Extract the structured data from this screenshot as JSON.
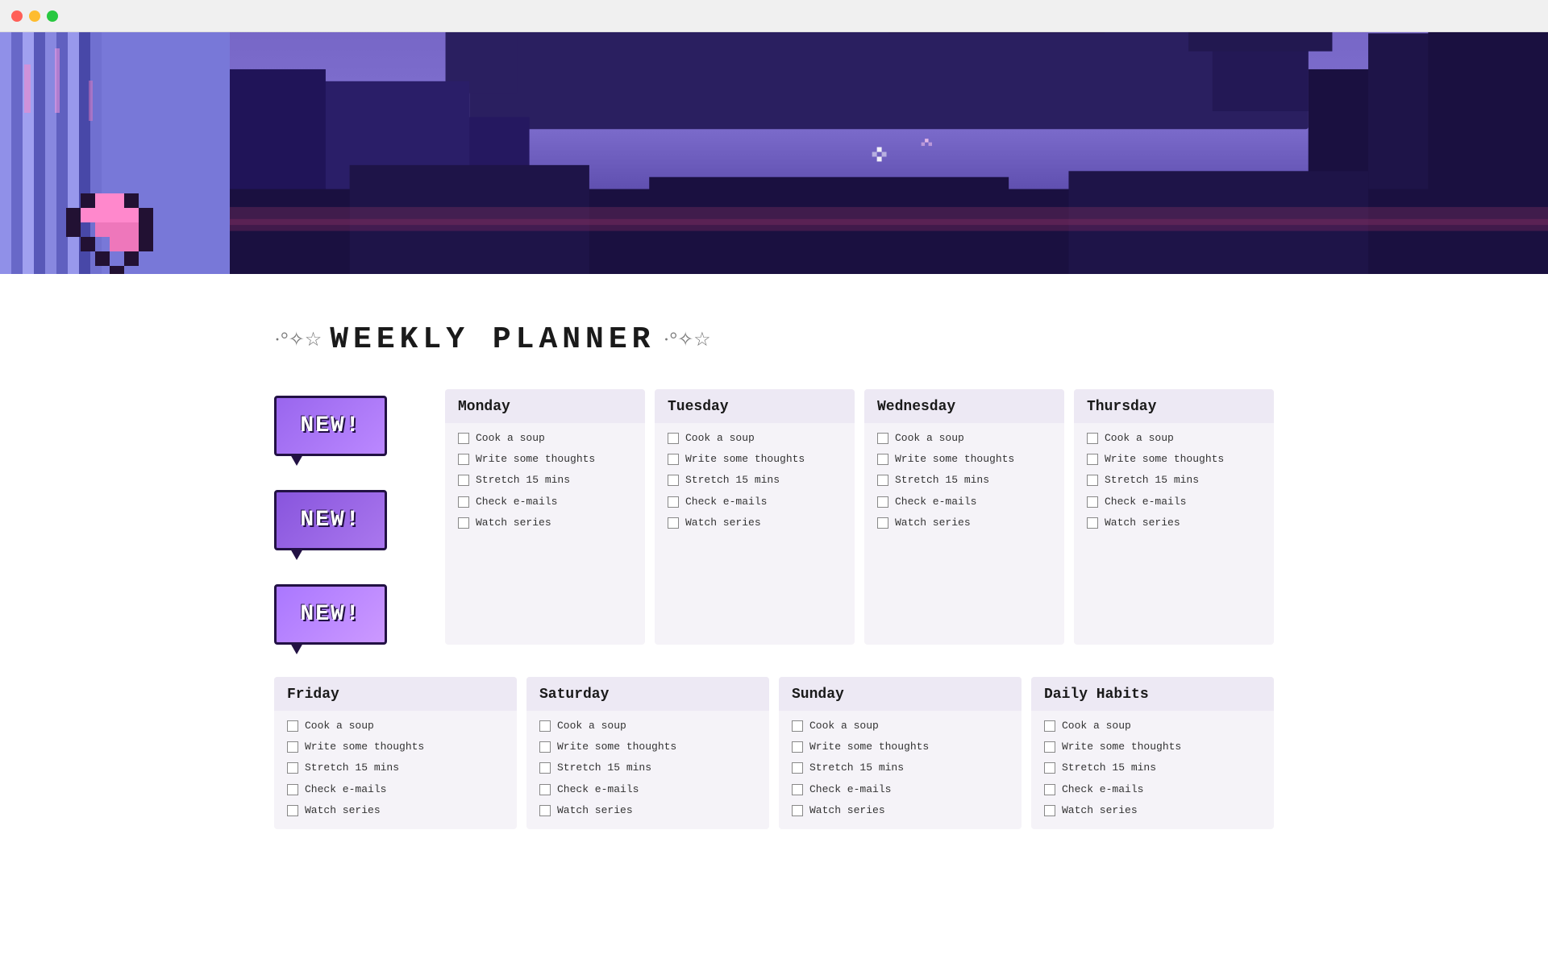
{
  "titlebar": {
    "buttons": [
      "close",
      "minimize",
      "maximize"
    ]
  },
  "title": "WEEKLY PLANNER",
  "title_deco_left": "·°✧☆",
  "title_deco_right": "·°✧☆",
  "days": [
    {
      "name": "Monday",
      "tasks": [
        "Cook a soup",
        "Write some thoughts",
        "Stretch 15 mins",
        "Check e-mails",
        "Watch series"
      ]
    },
    {
      "name": "Tuesday",
      "tasks": [
        "Cook a soup",
        "Write some thoughts",
        "Stretch 15 mins",
        "Check e-mails",
        "Watch series"
      ]
    },
    {
      "name": "Wednesday",
      "tasks": [
        "Cook a soup",
        "Write some thoughts",
        "Stretch 15 mins",
        "Check e-mails",
        "Watch series"
      ]
    },
    {
      "name": "Thursday",
      "tasks": [
        "Cook a soup",
        "Write some thoughts",
        "Stretch 15 mins",
        "Check e-mails",
        "Watch series"
      ]
    },
    {
      "name": "Friday",
      "tasks": [
        "Cook a soup",
        "Write some thoughts",
        "Stretch 15 mins",
        "Check e-mails",
        "Watch series"
      ]
    },
    {
      "name": "Saturday",
      "tasks": [
        "Cook a soup",
        "Write some thoughts",
        "Stretch 15 mins",
        "Check e-mails",
        "Watch series"
      ]
    },
    {
      "name": "Sunday",
      "tasks": [
        "Cook a soup",
        "Write some thoughts",
        "Stretch 15 mins",
        "Check e-mails",
        "Watch series"
      ]
    },
    {
      "name": "Daily Habits",
      "tasks": [
        "Cook a soup",
        "Write some thoughts",
        "Stretch 15 mins",
        "Check e-mails",
        "Watch series"
      ]
    }
  ],
  "badges": [
    "NEW!",
    "NEW!",
    "NEW!"
  ]
}
